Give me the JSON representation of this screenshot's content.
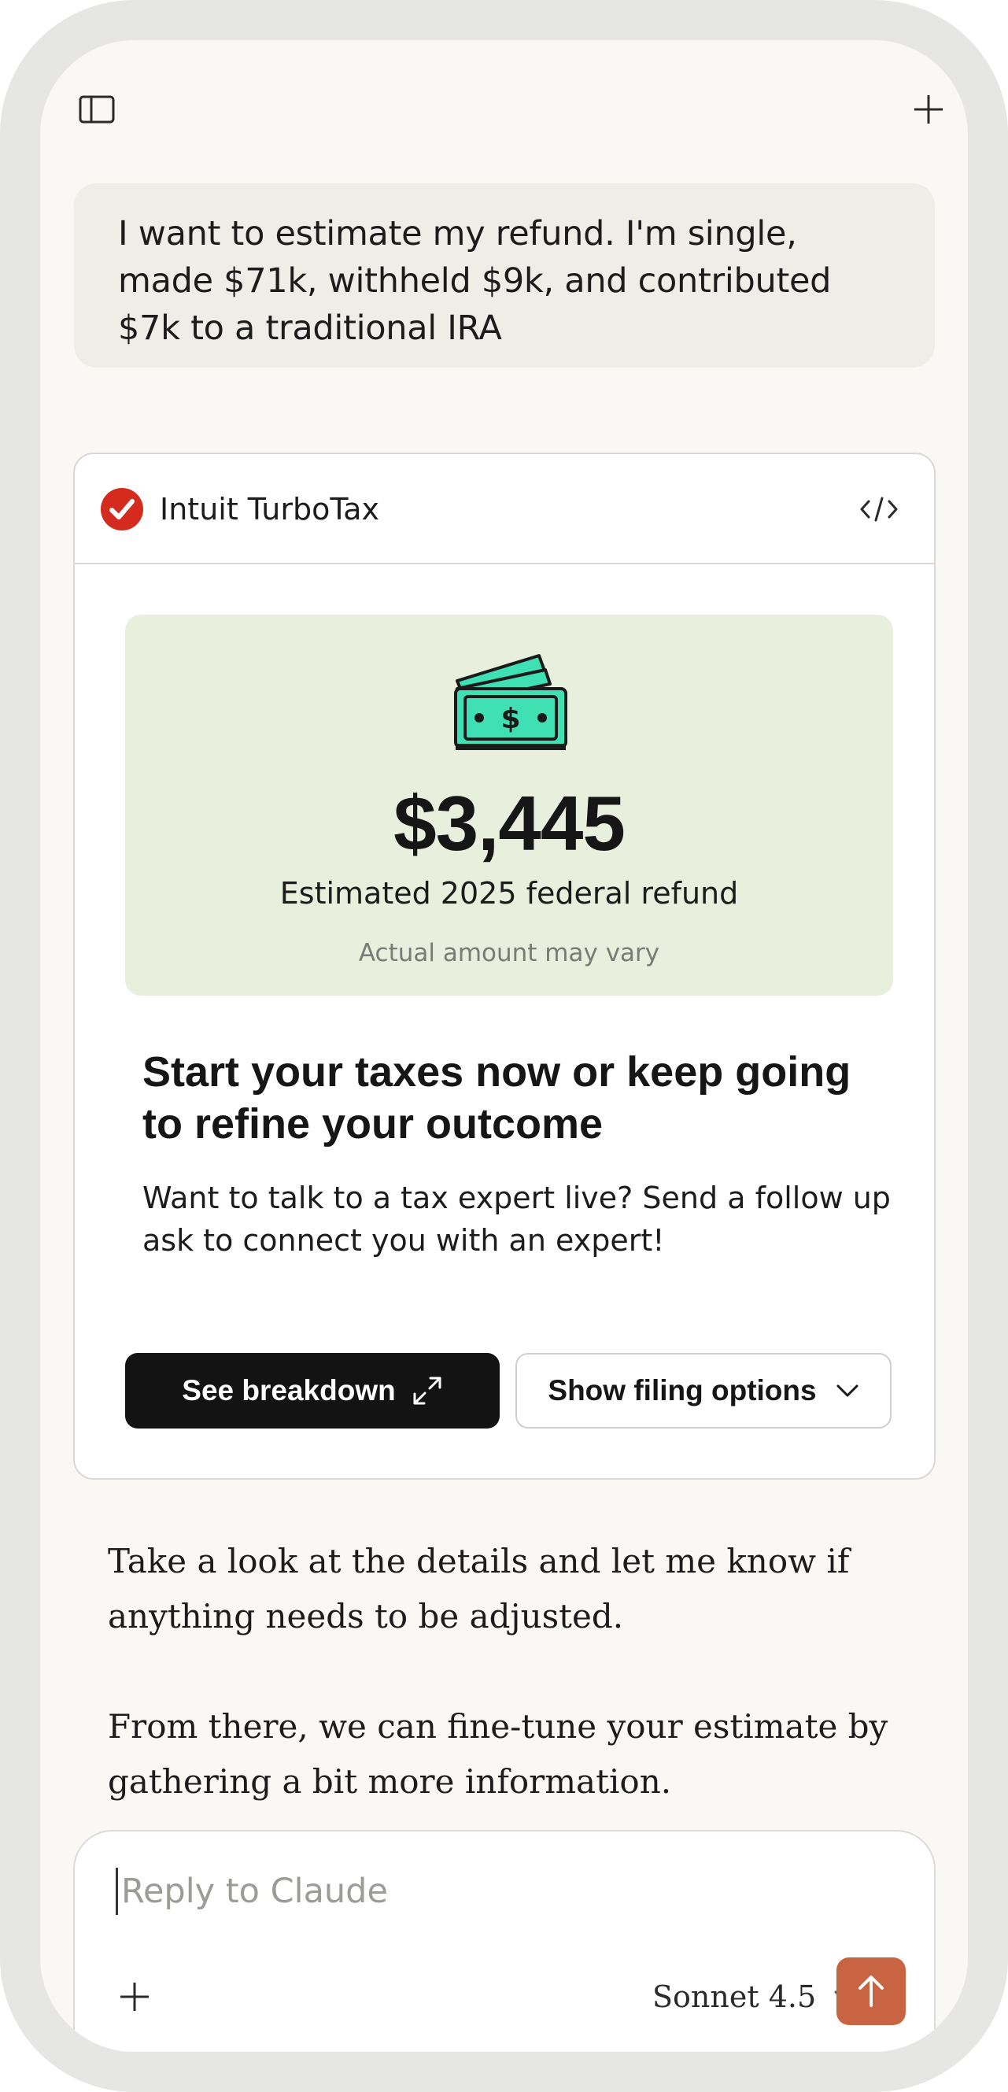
{
  "user_message": "I want to estimate my refund. I'm single, made $71k, withheld $9k, and contributed $7k to a traditional IRA",
  "widget": {
    "brand": "Intuit TurboTax",
    "refund": {
      "amount": "$3,445",
      "label": "Estimated 2025 federal refund",
      "note": "Actual amount may vary"
    },
    "cta_title": "Start your taxes now or keep going to refine your outcome",
    "cta_body": "Want to talk to a tax expert live? Send a follow up ask to connect you with an expert!",
    "primary_button": "See breakdown",
    "secondary_button": "Show filing options"
  },
  "assistant": {
    "paragraphs": [
      "Take a look at the details and let me know if anything needs to be adjusted.",
      "From there, we can fine-tune your estimate by gathering a bit more information."
    ]
  },
  "composer": {
    "placeholder": "Reply to Claude",
    "model": "Sonnet 4.5"
  },
  "colors": {
    "send_button": "#c96442",
    "refund_background": "#e8efdc",
    "brand_red": "#d52b1e",
    "money_green": "#3ee0b4"
  },
  "icons": {
    "sidebar": "sidebar-icon",
    "new_chat": "plus-icon",
    "code": "code-icon",
    "expand": "expand-icon",
    "dropdown": "chevron-down-icon",
    "attach": "plus-icon",
    "send": "arrow-up-icon"
  }
}
